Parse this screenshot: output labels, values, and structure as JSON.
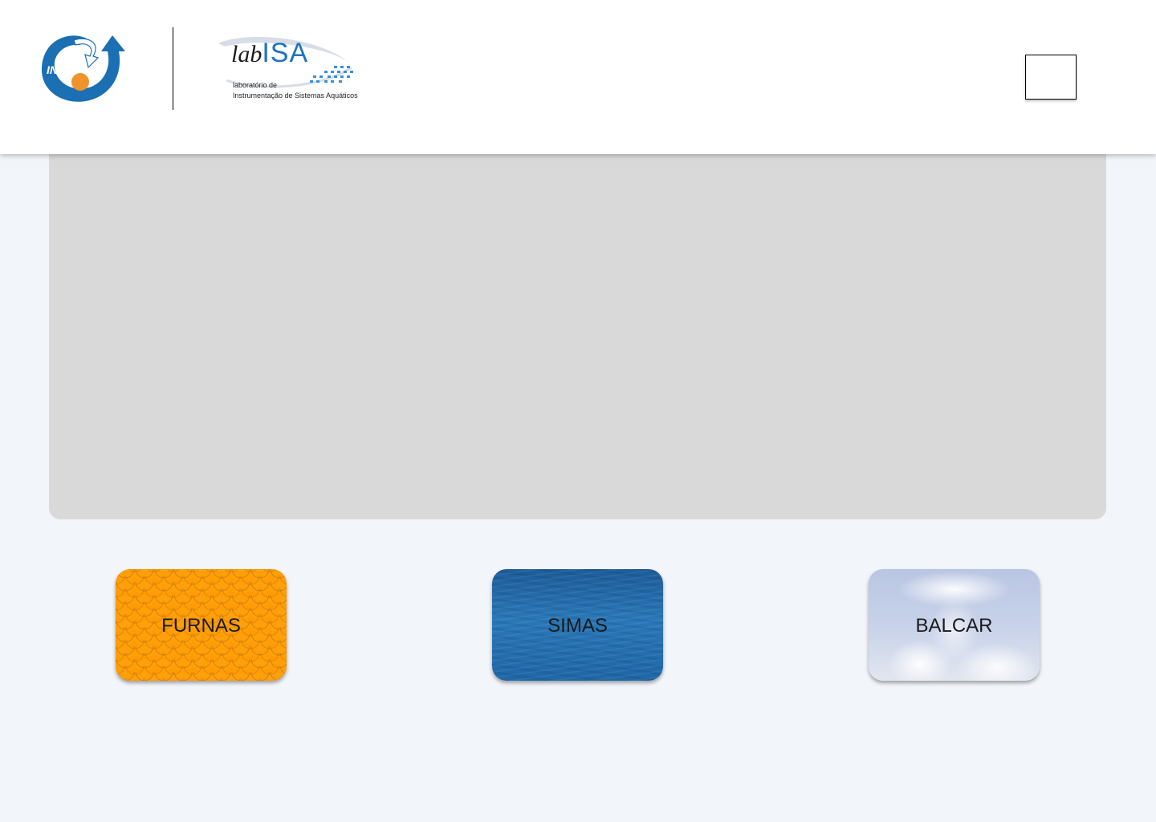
{
  "header": {
    "logos": {
      "inpe": {
        "icon": "inpe-logo",
        "text": "INPE",
        "colors": {
          "blue": "#1b6fb3",
          "orange": "#f0932b"
        }
      },
      "labisa": {
        "icon": "labisa-logo",
        "word_lab": "lab",
        "word_isa": "ISA",
        "subtitle_line1": "laboratório de",
        "subtitle_line2": "Instrumentação de Sistemas Aquáticos",
        "colors": {
          "blue": "#1e73be"
        }
      }
    },
    "menu_button": {
      "icon": "menu-icon"
    }
  },
  "projects": [
    {
      "id": "furnas",
      "label": "FURNAS",
      "color": "#ff9f0a"
    },
    {
      "id": "simas",
      "label": "SIMAS",
      "color": "#2a78b8"
    },
    {
      "id": "balcar",
      "label": "BALCAR",
      "color": "#c9d3ea"
    }
  ]
}
